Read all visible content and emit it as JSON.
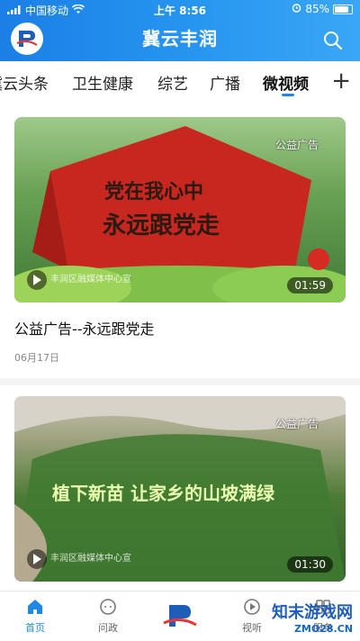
{
  "status_bar": {
    "carrier": "中国移动",
    "time": "上午 8:56",
    "battery": "85%"
  },
  "header": {
    "title": "冀云丰润"
  },
  "tabs": [
    {
      "label": "冀云头条"
    },
    {
      "label": "卫生健康"
    },
    {
      "label": "综艺"
    },
    {
      "label": "广播"
    },
    {
      "label": "微视频",
      "active": true
    }
  ],
  "add_tab_symbol": "+",
  "videos": [
    {
      "title": "公益广告--永远跟党走",
      "date": "06月17日",
      "duration": "01:59",
      "ad_label": "公益广告",
      "slogan_line1": "党在我心中",
      "slogan_line2": "永远跟党走",
      "watermark": "丰润区融媒体中心宣"
    },
    {
      "duration": "01:30",
      "ad_label": "公益广告",
      "slogan": "植下新苗 让家乡的山坡满绿",
      "watermark": "丰润区融媒体中心宣"
    }
  ],
  "bottom_nav": [
    {
      "label": "首页",
      "icon": "home-icon",
      "active": true
    },
    {
      "label": "问政",
      "icon": "chat-icon"
    },
    {
      "label": "视听",
      "icon": "play-icon"
    },
    {
      "label": "服务",
      "icon": "service-icon"
    }
  ],
  "site_watermark": {
    "name": "知末游戏网",
    "url": "ZMO28.CN"
  },
  "colors": {
    "primary": "#1e88e5",
    "header_start": "#1b7fe6",
    "header_end": "#3aa6f5",
    "banner_red": "#c8271f"
  }
}
